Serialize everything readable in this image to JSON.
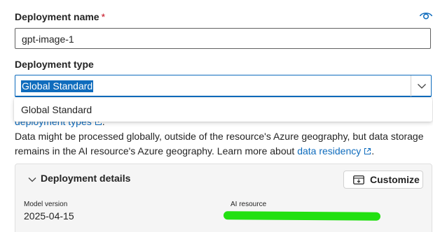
{
  "deployment_name": {
    "label": "Deployment name",
    "required_marker": "*",
    "value": "gpt-image-1",
    "toggle_icon": "eye-icon"
  },
  "deployment_type": {
    "label": "Deployment type",
    "selected": "Global Standard",
    "options": [
      "Global Standard"
    ],
    "dropdown_icon": "chevron-down-icon"
  },
  "info": {
    "partial_link": "deployment types",
    "partial_suffix": ".",
    "description_prefix": "Data might be processed globally, outside of the resource's Azure geography, but data storage remains in the AI resource's Azure geography. Learn more about ",
    "residency_link": "data residency",
    "description_suffix": ".",
    "link_icon": "external-link-icon"
  },
  "details": {
    "title": "Deployment details",
    "customize_label": "Customize",
    "model_version_label": "Model version",
    "model_version_value": "2025-04-15",
    "ai_resource_label": "AI resource"
  },
  "colors": {
    "accent": "#0f6cbd",
    "required": "#c50f1f",
    "redaction": "#22e011"
  }
}
